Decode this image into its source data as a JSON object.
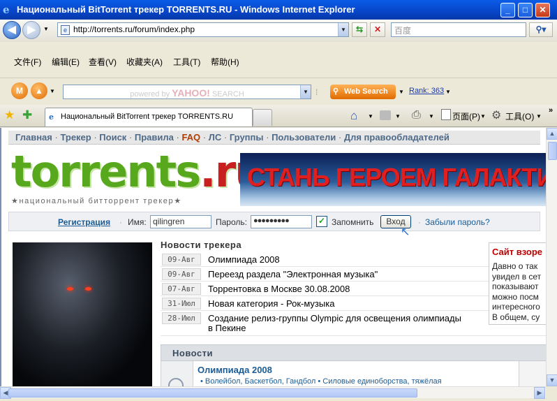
{
  "window": {
    "title": "Национальный BitTorrent трекер TORRENTS.RU - Windows Internet Explorer",
    "min": "_",
    "max": "□",
    "close": "✕"
  },
  "address": {
    "url": "http://torrents.ru/forum/index.php",
    "search_placeholder": "百度"
  },
  "menu": [
    "文件(F)",
    "编辑(E)",
    "查看(V)",
    "收藏夹(A)",
    "工具(T)",
    "帮助(H)"
  ],
  "yahoo": {
    "powered": "powered by",
    "brand": "YAHOO!",
    "search": "SEARCH",
    "websearch": "Web Search",
    "rank": "Rank: 363"
  },
  "tab": {
    "title": "Национальный BitTorrent трекер TORRENTS.RU"
  },
  "commandbar": {
    "page": "页面(P)",
    "tools": "工具(O)"
  },
  "site": {
    "nav": [
      "Главная",
      "Трекер",
      "Поиск",
      "Правила",
      "FAQ",
      "ЛС",
      "Группы",
      "Пользователи",
      "Для правообладателей"
    ],
    "logo_main": "torrents",
    "logo_tld": ".ru",
    "logo_sub": "★национальный битторрент трекер★",
    "banner": "СТАНЬ ГЕРОЕМ ГАЛАКТИКИ"
  },
  "login": {
    "register": "Регистрация",
    "name_label": "Имя:",
    "name_value": "qilingren",
    "password_label": "Пароль:",
    "password_value": "●●●●●●●●●",
    "remember": "Запомнить",
    "login_btn": "Вход",
    "forgot": "Забыли пароль?"
  },
  "tracker_news": {
    "title": "Новости трекера",
    "items": [
      {
        "date": "09-Авг",
        "text": "Олимпиада 2008"
      },
      {
        "date": "09-Авг",
        "text": "Переезд раздела \"Электронная музыка\""
      },
      {
        "date": "07-Авг",
        "text": "Торрентовка в Москве 30.08.2008"
      },
      {
        "date": "31-Июл",
        "text": "Новая категория - Рок-музыка"
      },
      {
        "date": "28-Июл",
        "text": "Создание релиз-группы Olympic для освещения олимпиады",
        "text2": "в Пекине"
      }
    ]
  },
  "news": {
    "title": "Новости",
    "item_title": "Олимпиада 2008",
    "item_sub": "• Волейбол, Баскетбол, Гандбол • Силовые единоборства, тяжёлая"
  },
  "sidebox": {
    "title": "Сайт взоре",
    "lines": [
      "Давно о так",
      "увидел в сет",
      "показывают",
      "можно посм",
      "интересного",
      "В общем, су"
    ]
  }
}
